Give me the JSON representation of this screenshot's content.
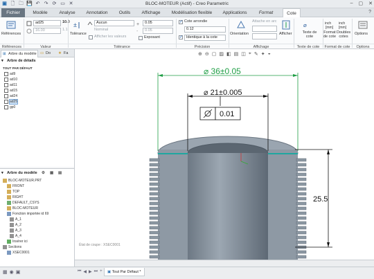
{
  "window": {
    "title": "BLOC-MOTEUR (Actif) - Creo Parametric"
  },
  "tabs": [
    {
      "label": "Fichier"
    },
    {
      "label": "Modèle"
    },
    {
      "label": "Analyse"
    },
    {
      "label": "Annotation"
    },
    {
      "label": "Outils"
    },
    {
      "label": "Affichage"
    },
    {
      "label": "Modélisation flexible"
    },
    {
      "label": "Applications"
    },
    {
      "label": "Format"
    },
    {
      "label": "Cote"
    }
  ],
  "ribbon": {
    "references": {
      "label": "Références",
      "group": "Références"
    },
    "valeur": {
      "name_value": "ad25",
      "value_field": "16.00",
      "value_icon": "10.0",
      "value_icon2": "1.1",
      "group": "Valeur"
    },
    "tolerance": {
      "label": "Tolérance",
      "mode": "Aucun",
      "nominal": "Nominal",
      "upper": "0.05",
      "lower": "0.05",
      "show_values": "Afficher les valeurs",
      "exposant": "Exposant",
      "group": "Tolérance"
    },
    "precision": {
      "cote_arrondie": "Cote arrondie",
      "valeur": "0.12",
      "identique": "Identique à la cote",
      "group": "Précision"
    },
    "affichage": {
      "orientation": "Orientation",
      "attache": "Attache en arc",
      "afficher": "Afficher",
      "group": "Affichage"
    },
    "texte_cote": {
      "label": "Texte de cote",
      "group": "Texte de cote"
    },
    "format_cote": {
      "format": "Format de cote",
      "doubles": "Doubles cotes",
      "group": "Format de cote"
    },
    "options": {
      "label": "Options",
      "group": "Options"
    }
  },
  "sidebar": {
    "tabs": [
      "Arbre du modèle",
      "Do",
      "Fa"
    ],
    "detail_tree": {
      "title": "Arbre de détails",
      "section": "TOUT PAR DÉFAUT",
      "items": [
        "ad9",
        "ad10",
        "ad11",
        "ad15",
        "ad24",
        "ad25",
        "gp0"
      ],
      "selected": "ad25"
    },
    "model_tree": {
      "title": "Arbre du modèle",
      "items": [
        {
          "label": "BLOC-MOTEUR.PRT"
        },
        {
          "label": "FRONT"
        },
        {
          "label": "TOP"
        },
        {
          "label": "RIGHT"
        },
        {
          "label": "DEFAULT_CSYS"
        },
        {
          "label": "BLOC-MOTEUR"
        },
        {
          "label": "Fonction importée id 69"
        },
        {
          "label": "A_1"
        },
        {
          "label": "A_2"
        },
        {
          "label": "A_3"
        },
        {
          "label": "A_4"
        },
        {
          "label": "Insérer ici"
        },
        {
          "label": "Sections"
        },
        {
          "label": "XSEC0001"
        }
      ]
    }
  },
  "drawing": {
    "dim_outer": "⌀ 36±0.05",
    "dim_inner": "⌀ 21±0.005",
    "tolerance_value": "0.01",
    "dim_height": "25.5",
    "section_label": "État de coupe : XSEC0001",
    "colors": {
      "dimension": "#1f9e45",
      "black": "#111111",
      "part": "#8f9ba6"
    }
  },
  "bottom": {
    "view_tab": "Tout Par Défaut *"
  }
}
